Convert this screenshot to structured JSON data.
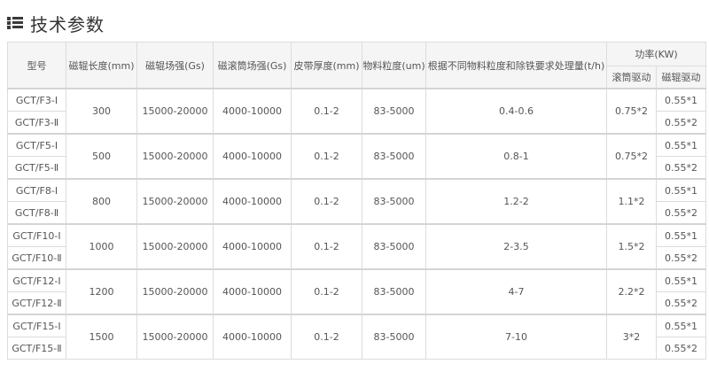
{
  "section": {
    "title": "技术参数",
    "icon": "list-icon"
  },
  "table": {
    "headers": {
      "model": "型号",
      "roller_length": "磁辊长度(mm)",
      "roller_field": "磁辊场强(Gs)",
      "drum_field": "磁滚筒场强(Gs)",
      "belt_thickness": "皮带厚度(mm)",
      "particle_size": "物料粒度(um)",
      "capacity": "根据不同物料粒度和除铁要求处理量(t/h)",
      "power": "功率(KW)",
      "drum_drive": "滚筒驱动",
      "roller_drive": "磁辊驱动"
    },
    "groups": [
      {
        "models": [
          "GCT/F3-Ⅰ",
          "GCT/F3-Ⅱ"
        ],
        "roller_length": "300",
        "roller_field": "15000-20000",
        "drum_field": "4000-10000",
        "belt_thickness": "0.1-2",
        "particle_size": "83-5000",
        "capacity": "0.4-0.6",
        "drum_drive": "0.75*2",
        "roller_drive": [
          "0.55*1",
          "0.55*2"
        ]
      },
      {
        "models": [
          "GCT/F5-Ⅰ",
          "GCT/F5-Ⅱ"
        ],
        "roller_length": "500",
        "roller_field": "15000-20000",
        "drum_field": "4000-10000",
        "belt_thickness": "0.1-2",
        "particle_size": "83-5000",
        "capacity": "0.8-1",
        "drum_drive": "0.75*2",
        "roller_drive": [
          "0.55*1",
          "0.55*2"
        ]
      },
      {
        "models": [
          "GCT/F8-Ⅰ",
          "GCT/F8-Ⅱ"
        ],
        "roller_length": "800",
        "roller_field": "15000-20000",
        "drum_field": "4000-10000",
        "belt_thickness": "0.1-2",
        "particle_size": "83-5000",
        "capacity": "1.2-2",
        "drum_drive": "1.1*2",
        "roller_drive": [
          "0.55*1",
          "0.55*2"
        ]
      },
      {
        "models": [
          "GCT/F10-Ⅰ",
          "GCT/F10-Ⅱ"
        ],
        "roller_length": "1000",
        "roller_field": "15000-20000",
        "drum_field": "4000-10000",
        "belt_thickness": "0.1-2",
        "particle_size": "83-5000",
        "capacity": "2-3.5",
        "drum_drive": "1.5*2",
        "roller_drive": [
          "0.55*1",
          "0.55*2"
        ]
      },
      {
        "models": [
          "GCT/F12-Ⅰ",
          "GCT/F12-Ⅱ"
        ],
        "roller_length": "1200",
        "roller_field": "15000-20000",
        "drum_field": "4000-10000",
        "belt_thickness": "0.1-2",
        "particle_size": "83-5000",
        "capacity": "4-7",
        "drum_drive": "2.2*2",
        "roller_drive": [
          "0.55*1",
          "0.55*2"
        ]
      },
      {
        "models": [
          "GCT/F15-Ⅰ",
          "GCT/F15-Ⅱ"
        ],
        "roller_length": "1500",
        "roller_field": "15000-20000",
        "drum_field": "4000-10000",
        "belt_thickness": "0.1-2",
        "particle_size": "83-5000",
        "capacity": "7-10",
        "drum_drive": "3*2",
        "roller_drive": [
          "0.55*1",
          "0.55*2"
        ]
      }
    ]
  }
}
